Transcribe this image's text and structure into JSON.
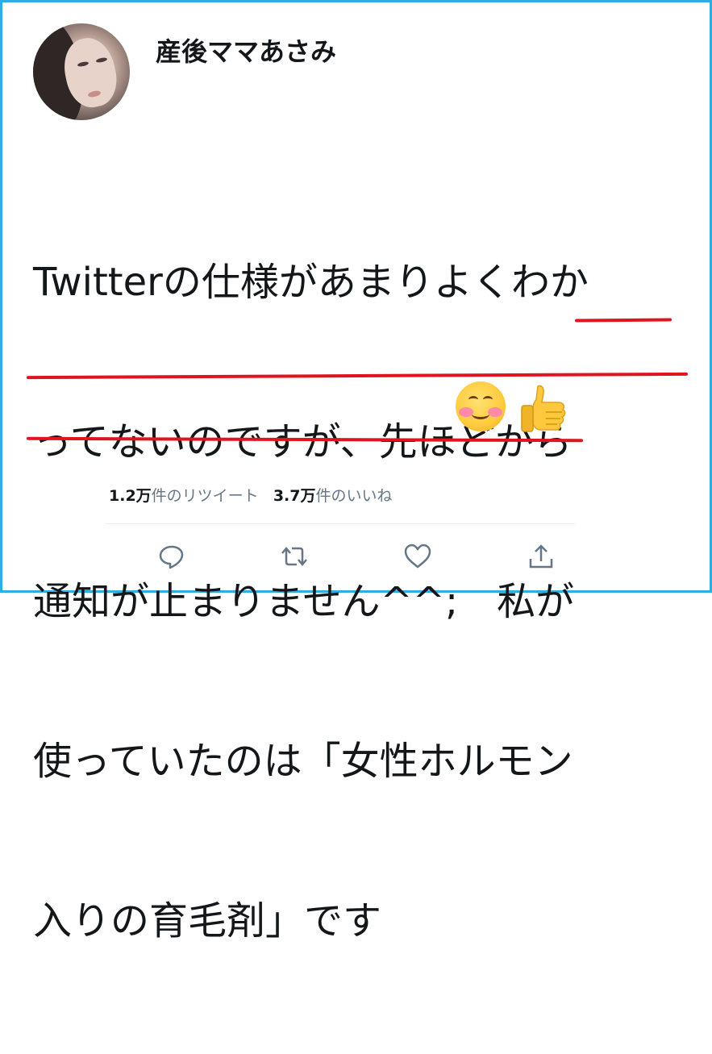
{
  "user": {
    "name": "産後ママあさみ"
  },
  "tweet": {
    "line1": "Twitterの仕様があまりよくわか",
    "line2": "ってないのですが、先ほどから",
    "line3": "通知が止まりません^^;　私が",
    "line4": "使っていたのは「女性ホルモン",
    "line5": "入りの育毛剤」です"
  },
  "stats": {
    "retweet_count": "1.2万",
    "retweet_label": "件のリツイート",
    "like_count": "3.7万",
    "like_label": "件のいいね"
  },
  "actions": [
    {
      "icon": "reply-icon"
    },
    {
      "icon": "retweet-icon"
    },
    {
      "icon": "like-icon"
    },
    {
      "icon": "share-icon"
    }
  ],
  "emojis": [
    "smiling-face-icon",
    "thumbs-up-icon"
  ],
  "colors": {
    "frame_border": "#2eaee0",
    "underline": "#e0141e",
    "text": "#14171a",
    "secondary_text": "#657786",
    "icon": "#657786"
  }
}
